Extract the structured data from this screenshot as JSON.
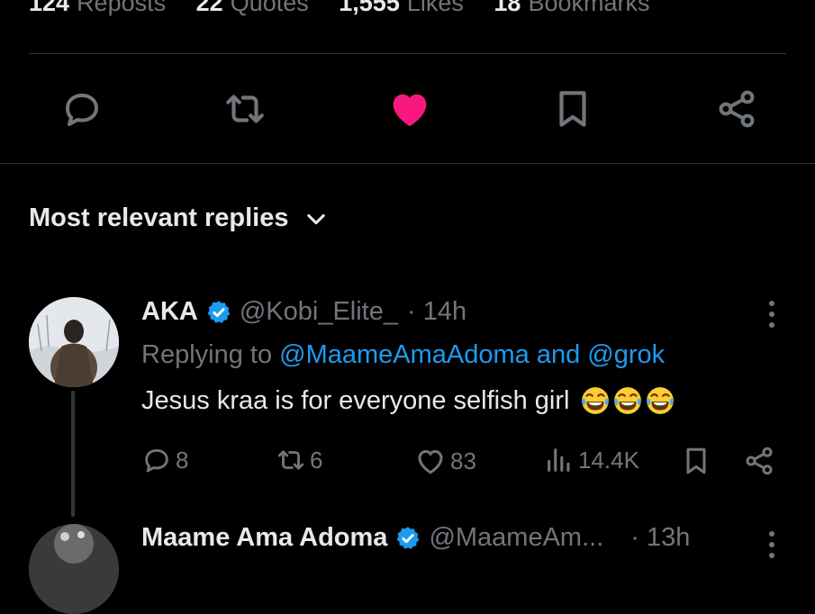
{
  "stats": [
    {
      "count": "124",
      "label": "Reposts"
    },
    {
      "count": "22",
      "label": "Quotes"
    },
    {
      "count": "1,555",
      "label": "Likes"
    },
    {
      "count": "18",
      "label": "Bookmarks"
    }
  ],
  "actions": [
    "reply-icon",
    "repost-icon",
    "like-icon-filled",
    "bookmark-icon",
    "share-icon"
  ],
  "filter": {
    "label": "Most relevant replies"
  },
  "reply1": {
    "name": "AKA",
    "handle": "@Kobi_Elite_",
    "time": "· 14h",
    "replying_prefix": "Replying to ",
    "replying_links": "@MaameAmaAdoma and @grok",
    "text": "Jesus kraa is for everyone selfish girl",
    "metrics": {
      "replies": "8",
      "reposts": "6",
      "likes": "83",
      "views": "14.4K"
    }
  },
  "reply2": {
    "name": "Maame Ama Adoma",
    "handle": "@MaameAm...",
    "time": "· 13h"
  },
  "colors": {
    "like": "#f91880",
    "link": "#1d9bf0",
    "muted": "#71767b",
    "verified": "#1d9bf0"
  }
}
